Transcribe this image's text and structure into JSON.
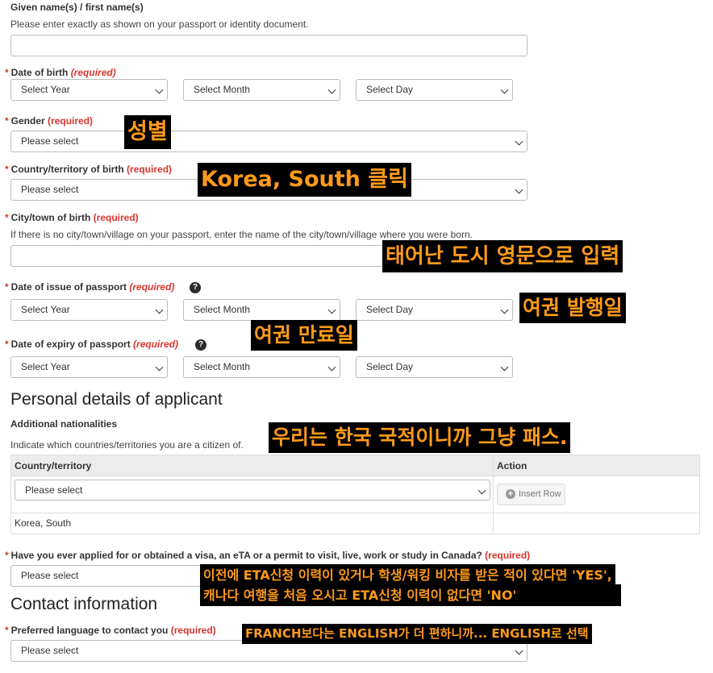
{
  "given_names": {
    "label": "Given name(s) / first name(s)",
    "help": "Please enter exactly as shown on your passport or identity document.",
    "value": ""
  },
  "dob": {
    "label": "Date of birth",
    "req": "(required)",
    "year": "Select Year",
    "month": "Select Month",
    "day": "Select Day"
  },
  "gender": {
    "label": "Gender",
    "req": "(required)",
    "value": "Please select"
  },
  "country_birth": {
    "label": "Country/territory of birth",
    "req": "(required)",
    "value": "Please select"
  },
  "city_birth": {
    "label": "City/town of birth",
    "req": "(required)",
    "help": "If there is no city/town/village on your passport, enter the name of the city/town/village where you were born.",
    "value": ""
  },
  "issue_date": {
    "label": "Date of issue of passport",
    "req": "(required)",
    "year": "Select Year",
    "month": "Select Month",
    "day": "Select Day"
  },
  "expiry_date": {
    "label": "Date of expiry of passport",
    "req": "(required)",
    "year": "Select Year",
    "month": "Select Month",
    "day": "Select Day"
  },
  "personal": {
    "heading": "Personal details of applicant",
    "sub": "Additional nationalities",
    "help": "Indicate which countries/territories you are a citizen of.",
    "table": {
      "col_country": "Country/territory",
      "col_action": "Action",
      "select_value": "Please select",
      "insert_label": "Insert Row",
      "rows": [
        "Korea, South"
      ]
    }
  },
  "visa_question": {
    "label": "Have you ever applied for or obtained a visa, an eTA or a permit to visit, live, work or study in Canada?",
    "req": "(required)",
    "value": "Please select"
  },
  "contact": {
    "heading": "Contact information",
    "lang_label": "Preferred language to contact you",
    "lang_req": "(required)",
    "lang_value": "Please select"
  },
  "annotations": {
    "gender": "성별",
    "country": "Korea, South 클릭",
    "city": "태어난 도시 영문으로 입력",
    "issue": "여권 발행일",
    "expiry": "여권 만료일",
    "nationality": "우리는 한국 국적이니까 그냥 패스.",
    "visa_line1": "이전에 ETA신청 이력이 있거나 학생/워킹 비자를 받은 적이 있다면 'YES',",
    "visa_line2": "캐나다 여행을 처음 오시고 ETA신청 이력이 없다면 'NO'",
    "language": "FRANCH보다는 ENGLISH가 더 편하니까... ENGLISH로 선택"
  },
  "colors": {
    "required": "#d9342b",
    "annotation_text": "#ff9a1a",
    "annotation_bg": "#000000"
  }
}
